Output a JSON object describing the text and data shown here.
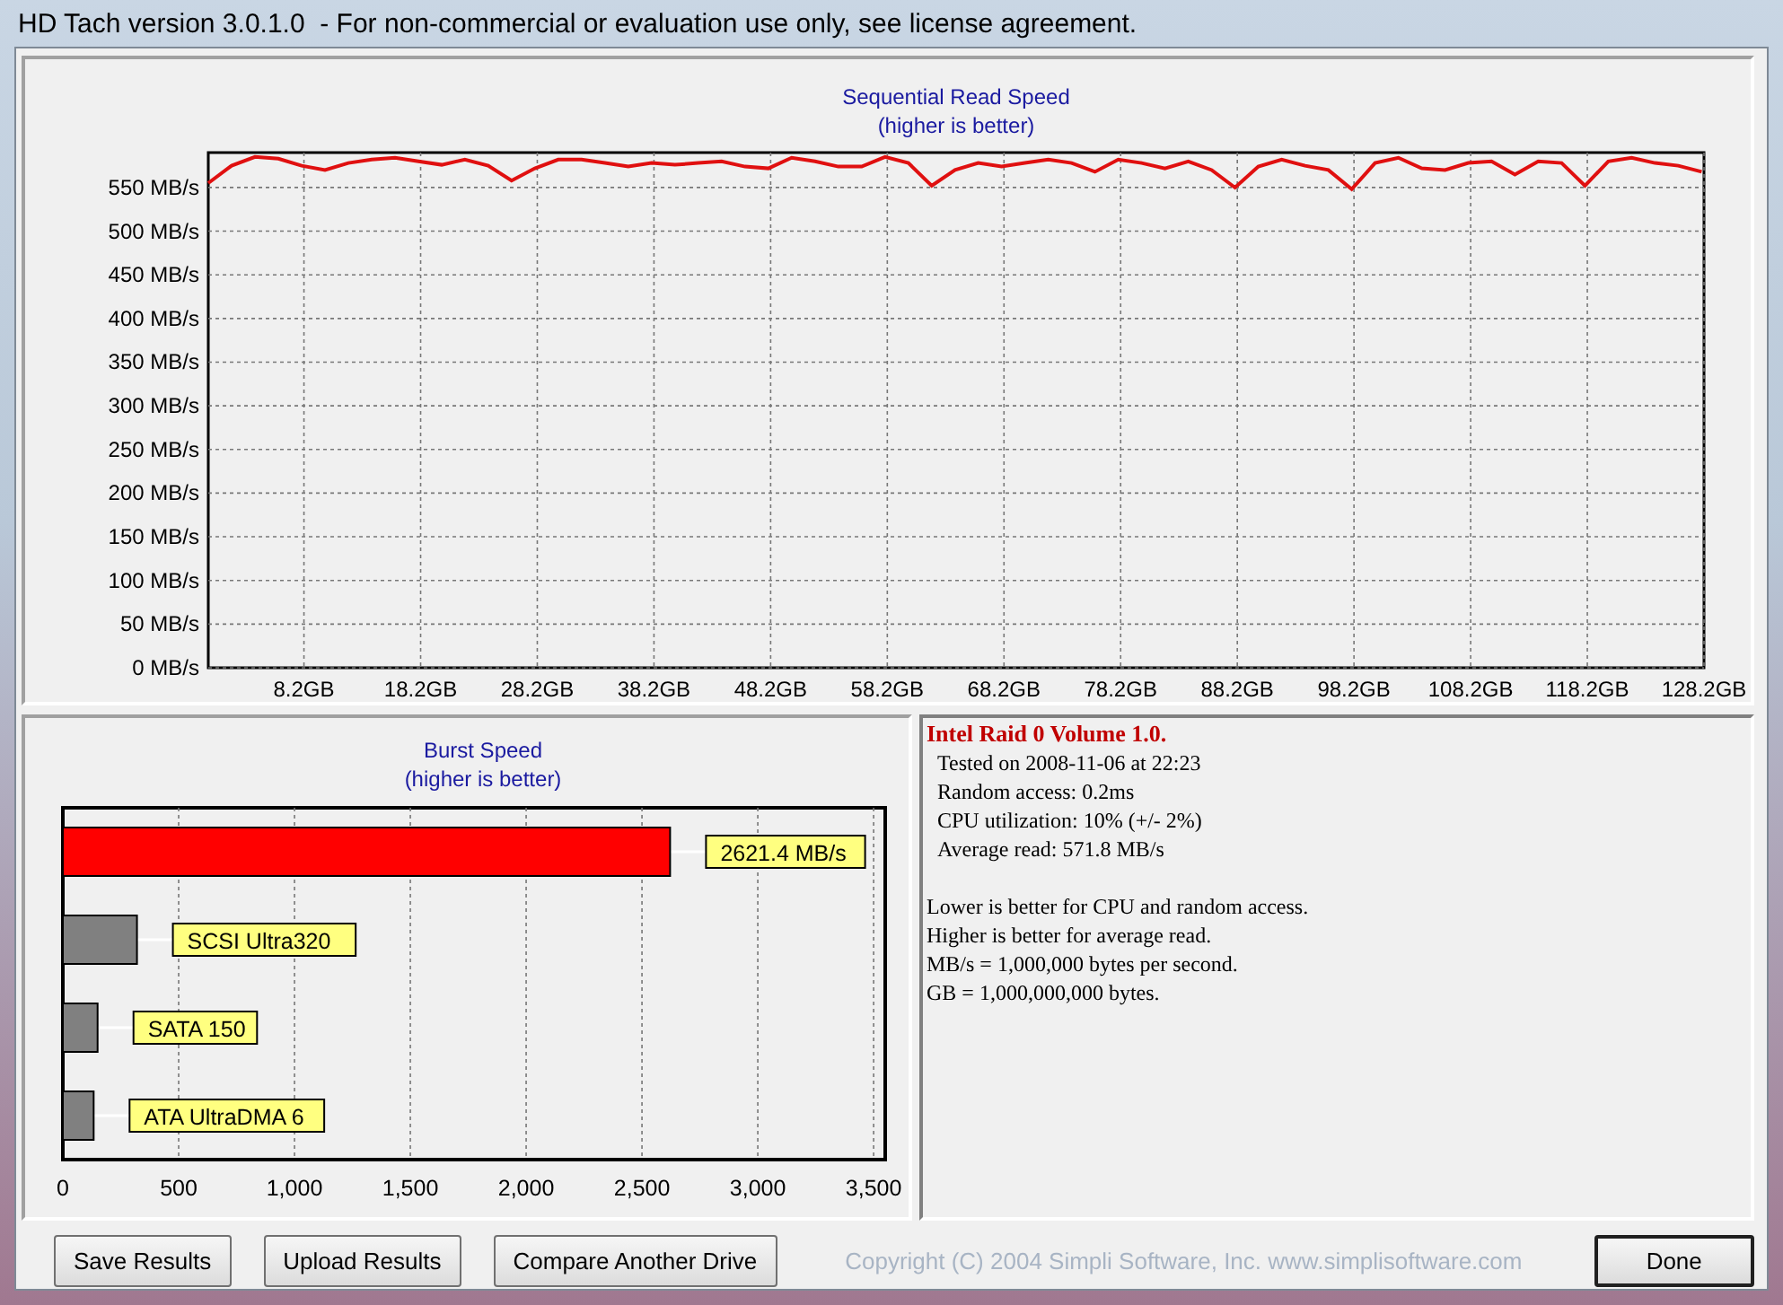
{
  "window": {
    "title": "HD Tach version 3.0.1.0  - For non-commercial or evaluation use only, see license agreement."
  },
  "read_chart": {
    "chart_data": {
      "type": "line",
      "title": "Sequential Read Speed\n(higher is better)",
      "x": [
        0,
        2,
        4,
        6,
        8,
        10,
        12,
        14,
        16,
        18,
        20,
        22,
        24,
        26,
        28,
        30,
        32,
        34,
        36,
        38,
        40,
        42,
        44,
        46,
        48,
        50,
        52,
        54,
        56,
        58,
        60,
        62,
        64,
        66,
        68,
        70,
        72,
        74,
        76,
        78,
        80,
        82,
        84,
        86,
        88,
        90,
        92,
        94,
        96,
        98,
        100,
        102,
        104,
        106,
        108,
        110,
        112,
        114,
        116,
        118,
        120,
        122,
        124,
        126,
        128
      ],
      "series": [
        {
          "color": "#e01010",
          "values": [
            555,
            575,
            585,
            583,
            575,
            570,
            578,
            582,
            584,
            580,
            576,
            582,
            575,
            558,
            572,
            582,
            582,
            578,
            574,
            578,
            576,
            578,
            580,
            574,
            572,
            584,
            580,
            574,
            574,
            585,
            578,
            552,
            570,
            578,
            574,
            578,
            582,
            578,
            568,
            582,
            578,
            572,
            580,
            570,
            550,
            574,
            582,
            575,
            570,
            548,
            578,
            584,
            572,
            570,
            578,
            580,
            565,
            580,
            578,
            552,
            580,
            584,
            578,
            575,
            568
          ]
        }
      ],
      "xlim": [
        0,
        128.2
      ],
      "ylim": [
        0,
        590
      ],
      "grid": true,
      "xticks": [
        {
          "value": 8.2,
          "label": "8.2GB"
        },
        {
          "value": 18.2,
          "label": "18.2GB"
        },
        {
          "value": 28.2,
          "label": "28.2GB"
        },
        {
          "value": 38.2,
          "label": "38.2GB"
        },
        {
          "value": 48.2,
          "label": "48.2GB"
        },
        {
          "value": 58.2,
          "label": "58.2GB"
        },
        {
          "value": 68.2,
          "label": "68.2GB"
        },
        {
          "value": 78.2,
          "label": "78.2GB"
        },
        {
          "value": 88.2,
          "label": "88.2GB"
        },
        {
          "value": 98.2,
          "label": "98.2GB"
        },
        {
          "value": 108.2,
          "label": "108.2GB"
        },
        {
          "value": 118.2,
          "label": "118.2GB"
        },
        {
          "value": 128.2,
          "label": "128.2GB"
        }
      ],
      "yticks": [
        {
          "value": 0,
          "label": "0 MB/s"
        },
        {
          "value": 50,
          "label": "50 MB/s"
        },
        {
          "value": 100,
          "label": "100 MB/s"
        },
        {
          "value": 150,
          "label": "150 MB/s"
        },
        {
          "value": 200,
          "label": "200 MB/s"
        },
        {
          "value": 250,
          "label": "250 MB/s"
        },
        {
          "value": 300,
          "label": "300 MB/s"
        },
        {
          "value": 350,
          "label": "350 MB/s"
        },
        {
          "value": 400,
          "label": "400 MB/s"
        },
        {
          "value": 450,
          "label": "450 MB/s"
        },
        {
          "value": 500,
          "label": "500 MB/s"
        },
        {
          "value": 550,
          "label": "550 MB/s"
        }
      ]
    }
  },
  "burst_chart": {
    "chart_data": {
      "type": "bar",
      "orientation": "horizontal",
      "title": "Burst Speed\n(higher is better)",
      "categories": [
        "2621.4 MB/s",
        "SCSI Ultra320",
        "SATA 150",
        "ATA UltraDMA 6"
      ],
      "series": [
        {
          "color": "#ff0000",
          "values": [
            2621.4,
            null,
            null,
            null
          ]
        },
        {
          "color": "#808080",
          "values": [
            null,
            320,
            150,
            133
          ]
        }
      ],
      "xlim": [
        0,
        3550
      ],
      "grid": true,
      "xticks": [
        {
          "value": 0,
          "label": "0"
        },
        {
          "value": 500,
          "label": "500"
        },
        {
          "value": 1000,
          "label": "1,000"
        },
        {
          "value": 1500,
          "label": "1,500"
        },
        {
          "value": 2000,
          "label": "2,000"
        },
        {
          "value": 2500,
          "label": "2,500"
        },
        {
          "value": 3000,
          "label": "3,000"
        },
        {
          "value": 3500,
          "label": "3,500"
        }
      ]
    }
  },
  "info": {
    "title": "Intel Raid 0 Volume 1.0.",
    "details": [
      "Tested on 2008-11-06 at 22:23",
      "Random access: 0.2ms",
      "CPU utilization: 10% (+/- 2%)",
      "Average read: 571.8 MB/s"
    ],
    "notes": [
      "Lower is better for CPU and random access.",
      "Higher is better for average read.",
      "MB/s = 1,000,000 bytes per second.",
      "GB = 1,000,000,000 bytes."
    ]
  },
  "buttons": [
    {
      "label": "Save Results",
      "default": false
    },
    {
      "label": "Upload Results",
      "default": false
    },
    {
      "label": "Compare Another Drive",
      "default": false
    }
  ],
  "copyright": "Copyright (C) 2004 Simpli Software, Inc. www.simplisoftware.com",
  "done_button": {
    "label": "Done",
    "default": true
  }
}
